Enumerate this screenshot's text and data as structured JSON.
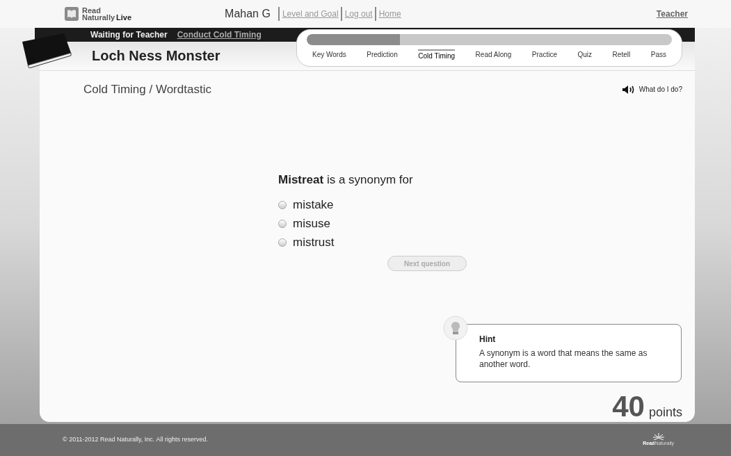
{
  "header": {
    "logo": {
      "line1": "Read",
      "line2a": "Naturally",
      "line2b": "Live"
    },
    "user": "Mahan G",
    "links": [
      "Level and Goal",
      "Log out",
      "Home"
    ],
    "teacher_link": "Teacher"
  },
  "status_bar": {
    "status": "Waiting for Teacher",
    "link": "Conduct Cold Timing"
  },
  "story": {
    "title": "Loch Ness Monster"
  },
  "progress": {
    "level": 0.255,
    "steps": [
      {
        "label": "Key Words",
        "selected": false
      },
      {
        "label": "Prediction",
        "selected": false
      },
      {
        "label": "Cold Timing",
        "selected": true
      },
      {
        "label": "Read Along",
        "selected": false
      },
      {
        "label": "Practice",
        "selected": false
      },
      {
        "label": "Quiz",
        "selected": false
      },
      {
        "label": "Retell",
        "selected": false
      },
      {
        "label": "Pass",
        "selected": false
      }
    ]
  },
  "section_title": "Cold Timing / Wordtastic",
  "help": "What do I do?",
  "question": {
    "prompt": "**Mistreat** is a synonym for",
    "options": [
      {
        "label": "mistake",
        "selected": false
      },
      {
        "label": "misuse",
        "selected": false
      },
      {
        "label": "mistrust",
        "selected": false
      }
    ],
    "next_button": {
      "label": "Next question",
      "disabled": true
    }
  },
  "hint": {
    "title": "Hint",
    "text": "A synonym is a word that means the same as another word."
  },
  "score": {
    "value": "40",
    "unit": "points"
  },
  "footer": {
    "copyright": "© 2011-2012 Read Naturally, Inc. All rights reserved.",
    "logo_a": "Read",
    "logo_b": "Naturally"
  }
}
